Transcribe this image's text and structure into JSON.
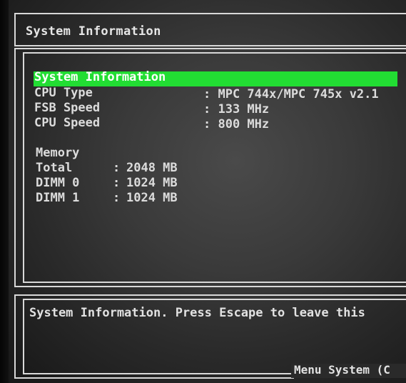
{
  "header": {
    "title": "System Information"
  },
  "section": {
    "heading": "System Information"
  },
  "cpu": {
    "type_label": "CPU Type",
    "type_value": ": MPC 744x/MPC 745x v2.1",
    "fsb_label": "FSB Speed",
    "fsb_value": ": 133 MHz",
    "speed_label": "CPU Speed",
    "speed_value": ": 800 MHz"
  },
  "memory": {
    "heading": "Memory",
    "rows": [
      {
        "label": "Total",
        "sep": ":",
        "value": "2048 MB"
      },
      {
        "label": "DIMM 0",
        "sep": ":",
        "value": "1024 MB"
      },
      {
        "label": "DIMM 1",
        "sep": ":",
        "value": "1024 MB"
      }
    ]
  },
  "help": {
    "text": "System Information. Press Escape to leave this"
  },
  "footer": {
    "text": "Menu System (C"
  },
  "colors": {
    "highlight": "#22dd33",
    "text": "#dcdcdc",
    "border": "#d8d8d8"
  }
}
